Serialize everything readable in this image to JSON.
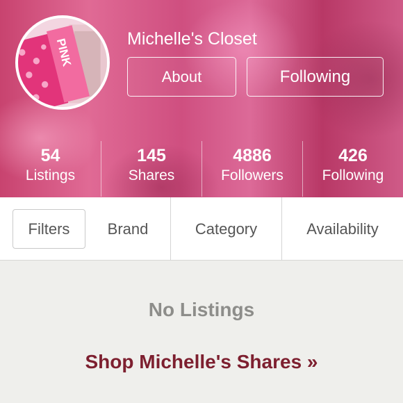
{
  "profile": {
    "closet_name": "Michelle's Closet",
    "about_label": "About",
    "following_button_label": "Following",
    "avatar_icon": "pink-shopping-bags-photo",
    "avatar_bag_text": "PINK"
  },
  "stats": [
    {
      "value": "54",
      "label": "Listings"
    },
    {
      "value": "145",
      "label": "Shares"
    },
    {
      "value": "4886",
      "label": "Followers"
    },
    {
      "value": "426",
      "label": "Following"
    }
  ],
  "filters": {
    "filters_label": "Filters",
    "brand_label": "Brand",
    "category_label": "Category",
    "availability_label": "Availability"
  },
  "main": {
    "empty_text": "No Listings",
    "shop_link": "Shop Michelle's Shares »"
  },
  "colors": {
    "header_pink": "#d85a8c",
    "link_maroon": "#7d1f2f",
    "muted_text": "#8d8d8a",
    "background": "#efefec"
  }
}
